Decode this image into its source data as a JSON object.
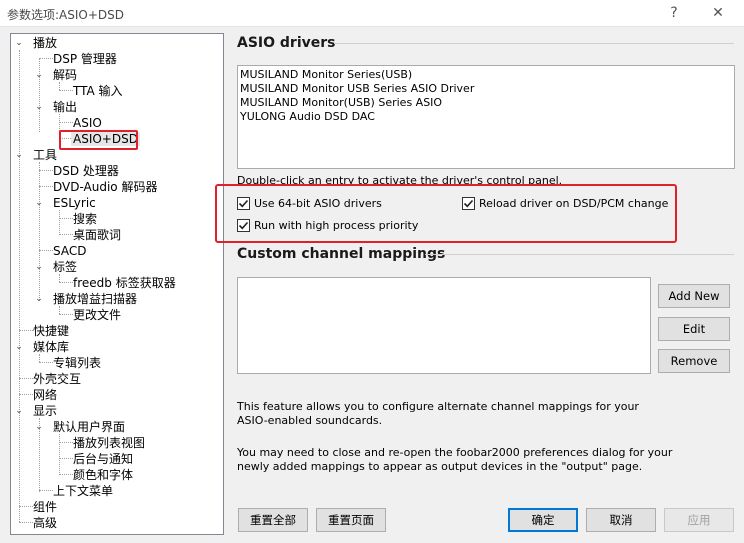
{
  "window": {
    "title": "参数选项:ASIO+DSD",
    "help_glyph": "?",
    "close_glyph": "✕"
  },
  "tree": {
    "items": [
      {
        "label": "播放",
        "expanded": true
      },
      {
        "label": "DSP 管理器"
      },
      {
        "label": "解码",
        "expanded": true
      },
      {
        "label": "TTA 输入"
      },
      {
        "label": "输出",
        "expanded": true
      },
      {
        "label": "ASIO"
      },
      {
        "label": "ASIO+DSD",
        "selected": true
      },
      {
        "label": "工具",
        "expanded": true
      },
      {
        "label": "DSD 处理器"
      },
      {
        "label": "DVD-Audio 解码器"
      },
      {
        "label": "ESLyric",
        "expanded": true
      },
      {
        "label": "搜索"
      },
      {
        "label": "桌面歌词"
      },
      {
        "label": "SACD"
      },
      {
        "label": "标签",
        "expanded": true
      },
      {
        "label": "freedb 标签获取器"
      },
      {
        "label": "播放增益扫描器",
        "expanded": true
      },
      {
        "label": "更改文件"
      },
      {
        "label": "快捷键"
      },
      {
        "label": "媒体库",
        "expanded": true
      },
      {
        "label": "专辑列表"
      },
      {
        "label": "外壳交互"
      },
      {
        "label": "网络"
      },
      {
        "label": "显示",
        "expanded": true
      },
      {
        "label": "默认用户界面",
        "expanded": true
      },
      {
        "label": "播放列表视图"
      },
      {
        "label": "后台与通知"
      },
      {
        "label": "颜色和字体"
      },
      {
        "label": "上下文菜单"
      },
      {
        "label": "组件"
      },
      {
        "label": "高级"
      }
    ]
  },
  "asio": {
    "section_title": "ASIO drivers",
    "drivers": [
      "MUSILAND Monitor Series(USB)",
      "MUSILAND Monitor USB Series ASIO Driver",
      "MUSILAND Monitor(USB) Series ASIO",
      "YULONG Audio DSD DAC"
    ],
    "hint": "Double-click an entry to activate the driver's control panel.",
    "use64bit": {
      "label": "Use 64-bit ASIO drivers",
      "checked": true
    },
    "reload": {
      "label": "Reload driver on DSD/PCM change",
      "checked": true
    },
    "high_priority": {
      "label": "Run with high process priority",
      "checked": true
    }
  },
  "mappings": {
    "section_title": "Custom channel mappings",
    "add_new": "Add New",
    "edit": "Edit",
    "remove": "Remove",
    "info1": "This feature allows you to configure alternate channel mappings for your ASIO-enabled soundcards.",
    "info2": "You may need to close and re-open the foobar2000 preferences dialog for your newly added mappings to appear as output devices in the \"output\" page."
  },
  "footer": {
    "reset_all": "重置全部",
    "reset_page": "重置页面",
    "ok": "确定",
    "cancel": "取消",
    "apply": "应用"
  },
  "colors": {
    "highlight_red": "#e0202a",
    "focus_blue": "#0078d7"
  }
}
